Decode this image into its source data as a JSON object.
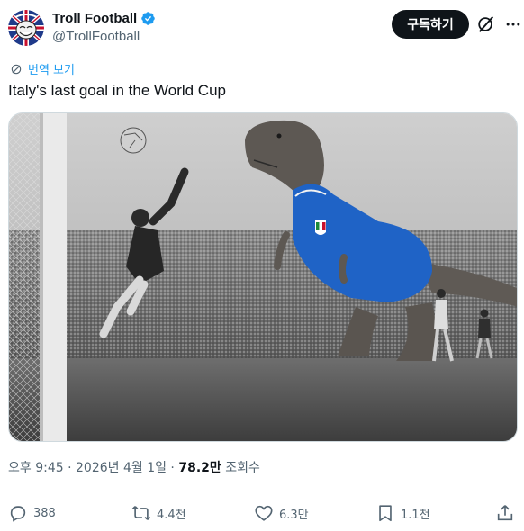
{
  "author": {
    "display_name": "Troll Football",
    "handle": "@TrollFootball",
    "avatar_icon": "troll-face-union-jack-avatar",
    "verified_icon": "verified-badge-icon",
    "verified_color": "#1d9bf0"
  },
  "header": {
    "subscribe_label": "구독하기",
    "grok_icon": "grok-icon",
    "more_icon": "more-icon"
  },
  "translate": {
    "label": "번역 보기",
    "icon": "globe-icon",
    "color": "#1d9bf0"
  },
  "tweet": {
    "text": "Italy's last goal in the World Cup",
    "media_icon": "photo-goalkeeper-trex-italy-shirt"
  },
  "meta": {
    "time": "오후 9:45 · 2026년 4월 1일 · ",
    "views_count": "78.2만",
    "views_label": " 조회수"
  },
  "actions": {
    "reply_count": "388",
    "retweet_count": "4.4천",
    "like_count": "6.3만",
    "bookmark_count": "1.1천",
    "icons": [
      "reply-icon",
      "retweet-icon",
      "like-icon",
      "bookmark-icon",
      "share-icon"
    ]
  }
}
